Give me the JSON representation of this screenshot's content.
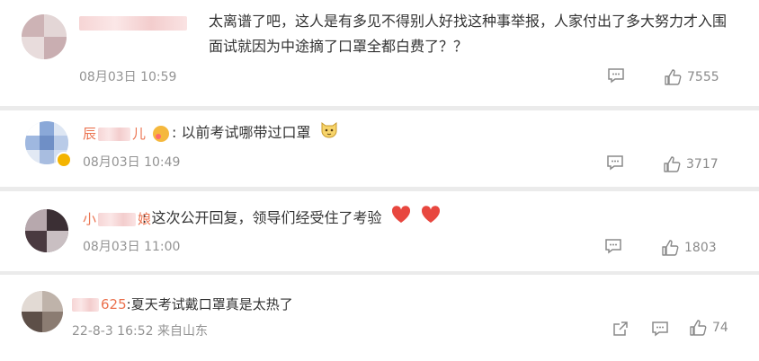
{
  "comments": [
    {
      "name_suffix": "",
      "text": "太离谱了吧，这人是有多见不得别人好找这种事举报，人家付出了多大努力才入围面试就因为中途摘了口罩全都白费了？？",
      "meta": "08月03日 10:59",
      "likes": "7555",
      "icons": {
        "reply": "comment-icon",
        "like": "thumb-up-icon"
      }
    },
    {
      "name_prefix": "辰",
      "name_suffix": "儿",
      "text": "以前考试哪带过口罩",
      "meta": "08月03日 10:49",
      "likes": "3717",
      "icons": {
        "reply": "comment-icon",
        "like": "thumb-up-icon"
      }
    },
    {
      "name_prefix": "小",
      "name_suffix": "娘",
      "text": "这次公开回复，领导们经受住了考验",
      "meta": "08月03日 11:00",
      "likes": "1803",
      "icons": {
        "reply": "comment-icon",
        "like": "thumb-up-icon"
      }
    },
    {
      "name_suffix": "625",
      "text": "夏天考试戴口罩真是太热了",
      "meta": "22-8-3 16:52 来自山东",
      "likes": "74",
      "icons": {
        "share": "share-icon",
        "reply": "comment-icon",
        "like": "thumb-up-icon"
      }
    }
  ],
  "colors": {
    "username": "#eb7350",
    "meta": "#939393",
    "background": "#ebebeb",
    "heart": "#e8473f"
  }
}
